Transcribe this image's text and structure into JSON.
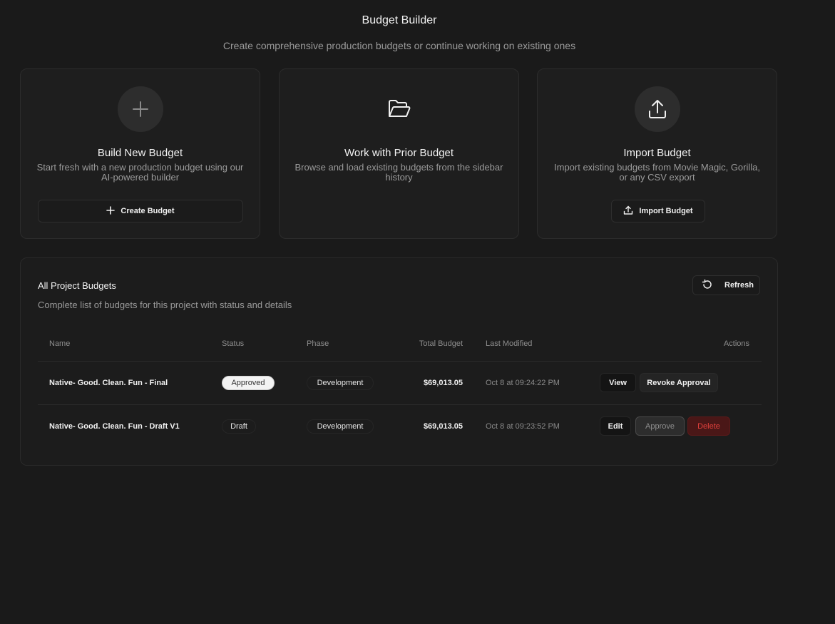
{
  "header": {
    "title": "Budget Builder",
    "subtitle": "Create comprehensive production budgets or continue working on existing ones"
  },
  "cards": {
    "new": {
      "icon": "plus-icon",
      "title": "Build New Budget",
      "description": "Start fresh with a new production budget using our AI-powered builder",
      "button": "Create Budget"
    },
    "prior": {
      "icon": "folder-open-icon",
      "title": "Work with Prior Budget",
      "description": "Browse and load existing budgets from the sidebar history"
    },
    "import": {
      "icon": "upload-icon",
      "title": "Import Budget",
      "description": "Import existing budgets from Movie Magic, Gorilla, or any CSV export",
      "button": "Import Budget"
    }
  },
  "budgets": {
    "title": "All Project Budgets",
    "subtitle": "Complete list of budgets for this project with status and details",
    "refresh_label": "Refresh",
    "columns": [
      "Name",
      "Status",
      "Phase",
      "Total Budget",
      "Last Modified",
      "Actions"
    ],
    "rows": [
      {
        "name": "Native- Good. Clean. Fun - Final",
        "status": "Approved",
        "phase": "Development",
        "total": "$69,013.05",
        "modified": "Oct 8 at 09:24:22 PM",
        "actions": [
          "View",
          "Revoke Approval"
        ]
      },
      {
        "name": "Native- Good. Clean. Fun - Draft V1",
        "status": "Draft",
        "phase": "Development",
        "total": "$69,013.05",
        "modified": "Oct 8 at 09:23:52 PM",
        "actions": [
          "Edit",
          "Approve",
          "Delete"
        ]
      }
    ]
  },
  "colors": {
    "background": "#1a1a1a",
    "card": "#1e1e1e",
    "delete": "#e0403c",
    "approved_pill": "#f3f3f3"
  }
}
